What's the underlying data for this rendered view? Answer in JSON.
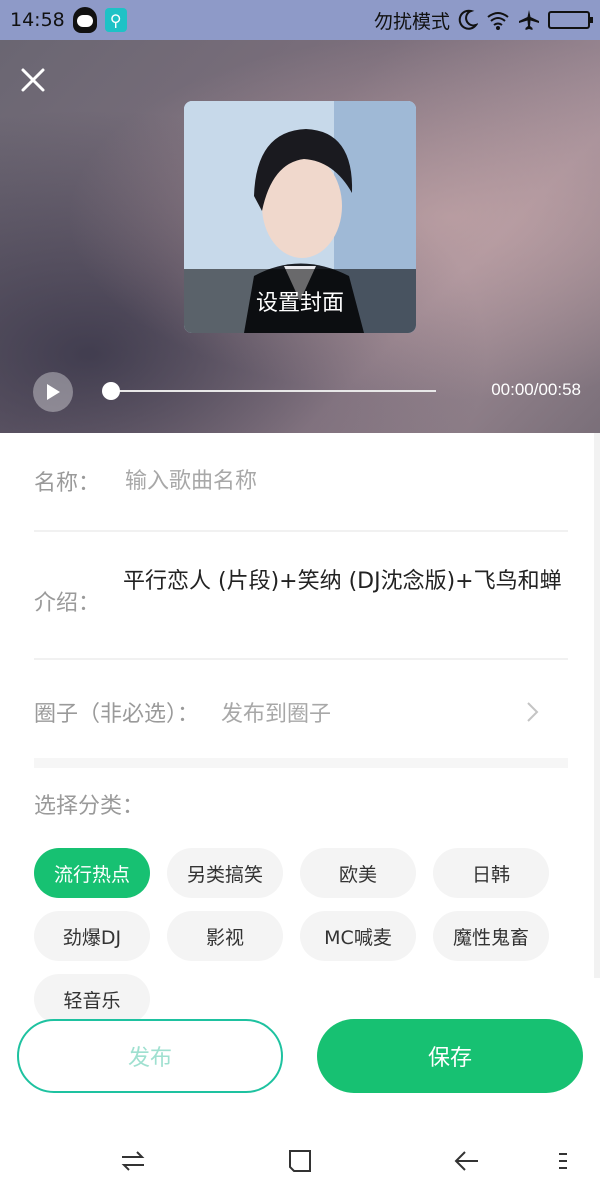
{
  "status_bar": {
    "time": "14:58",
    "dnd_label": "勿扰模式",
    "icons": [
      "qq-icon",
      "usb-icon",
      "moon-icon",
      "wifi-icon",
      "airplane-icon",
      "battery-icon"
    ]
  },
  "player": {
    "cover_label": "设置封面",
    "time_display": "00:00/00:58",
    "progress": 0
  },
  "form": {
    "name_label": "名称：",
    "name_placeholder": "输入歌曲名称",
    "name_value": "",
    "intro_label": "介绍：",
    "intro_text": "平行恋人 (片段)+笑纳 (DJ沈念版)+飞鸟和蝉",
    "circle_label": "圈子（非必选）：",
    "circle_value": "发布到圈子",
    "category_label": "选择分类："
  },
  "categories": [
    {
      "label": "流行热点",
      "selected": true
    },
    {
      "label": "另类搞笑",
      "selected": false
    },
    {
      "label": "欧美",
      "selected": false
    },
    {
      "label": "日韩",
      "selected": false
    },
    {
      "label": "劲爆DJ",
      "selected": false
    },
    {
      "label": "影视",
      "selected": false
    },
    {
      "label": "MC喊麦",
      "selected": false
    },
    {
      "label": "魔性鬼畜",
      "selected": false
    },
    {
      "label": "轻音乐",
      "selected": false
    }
  ],
  "actions": {
    "publish_label": "发布",
    "save_label": "保存"
  },
  "colors": {
    "accent": "#17c172",
    "status_bar": "#8e9ac8"
  }
}
